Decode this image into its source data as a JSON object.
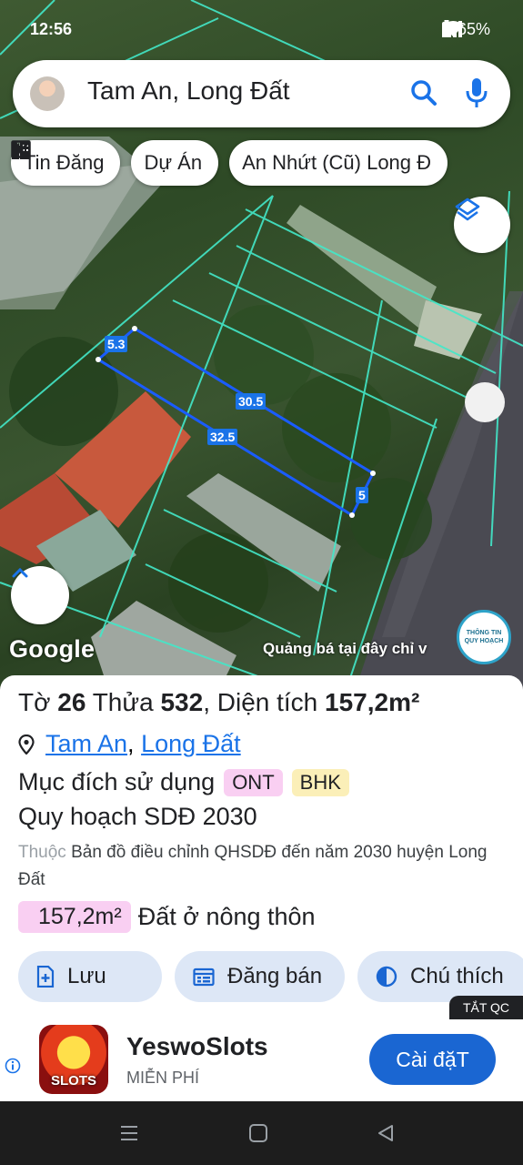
{
  "status": {
    "time": "12:56",
    "battery": "65%"
  },
  "search": {
    "query": "Tam An, Long Đất"
  },
  "chips": [
    {
      "icon": "listing-icon",
      "label": "Tin Đăng"
    },
    {
      "icon": "building-icon",
      "label": "Dự Án"
    },
    {
      "icon": "tools-icon",
      "label": "An Nhứt (Cũ) Long Đ"
    }
  ],
  "map": {
    "google_label": "Google",
    "promo": "Quảng bá tại đây chỉ v",
    "badge": "THÔNG TIN QUY HOẠCH",
    "dimensions": {
      "top": "30.5",
      "bottom": "32.5",
      "left": "5.3",
      "right": "5"
    }
  },
  "parcel": {
    "sheet_label": "Tờ",
    "sheet_no": "26",
    "lot_label": "Thửa",
    "lot_no": "532",
    "area_label": "Diện tích",
    "area": "157,2m²",
    "location": {
      "ward": "Tam An",
      "district": "Long Đất",
      "sep": ","
    },
    "purpose_label": "Mục đích sử dụng",
    "tags": [
      "ONT",
      "BHK"
    ],
    "plan_year": "Quy hoạch SDĐ 2030",
    "belongs_prefix": "Thuộc",
    "belongs_text": "Bản đồ điều chỉnh QHSDĐ đến năm 2030 huyện Long Đất",
    "area_chip": "157,2m²",
    "area_type": "Đất ở nông thôn"
  },
  "actions": [
    {
      "icon": "save-icon",
      "label": "Lưu"
    },
    {
      "icon": "calendar-icon",
      "label": "Đăng bán"
    },
    {
      "icon": "contrast-icon",
      "label": "Chú thích"
    }
  ],
  "ad": {
    "close_label": "TẮT QC",
    "app_name": "YeswoSlots",
    "price": "MIỄN PHÍ",
    "install": "Cài đặT",
    "icon_text": "SLOTS"
  }
}
